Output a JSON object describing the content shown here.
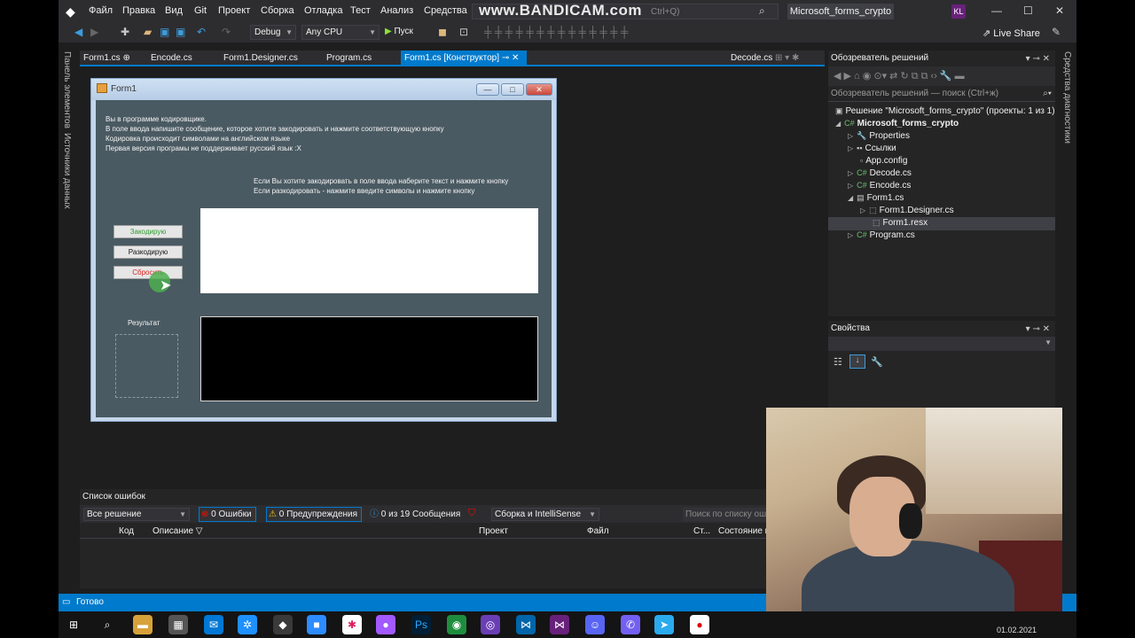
{
  "menu": [
    "Файл",
    "Правка",
    "Вид",
    "Git",
    "Проект",
    "Сборка",
    "Отладка",
    "Тест",
    "Анализ",
    "Средства",
    "Р"
  ],
  "watermark": "www.BANDICAM.com",
  "search_hint": "Ctrl+Q)",
  "solution_name": "Microsoft_forms_crypto",
  "user_initials": "KL",
  "window_buttons": {
    "minimize": "—",
    "maximize": "☐",
    "close": "✕"
  },
  "toolbar": {
    "config": "Debug",
    "platform": "Any CPU",
    "run": "Пуск",
    "live_share": "Live Share"
  },
  "left_tool_windows": [
    "Панель элементов",
    "Источники данных"
  ],
  "right_tool_windows": [
    "Средства диагностики"
  ],
  "doc_tabs": [
    {
      "label": "Form1.cs",
      "pin": "⊕"
    },
    {
      "label": "Encode.cs"
    },
    {
      "label": "Form1.Designer.cs"
    },
    {
      "label": "Program.cs"
    }
  ],
  "active_tab": "Form1.cs [Конструктор]",
  "right_tab": "Decode.cs",
  "form": {
    "title": "Form1",
    "info_lines": [
      "Вы в программе кодировщике.",
      "В поле ввода напишите сообщение, которое хотите закодировать и нажмите соответствующую кнопку",
      "Кодировка происходит символами на английском языке",
      "Первая версия програмы не поддерживает русский язык :Х"
    ],
    "hint_lines": [
      "Если Вы хотите закодировать в поле ввода наберите текст и нажмите кнопку",
      "Если разкодировать - нажмите введите символы и нажмите кнопку"
    ],
    "encode_button": "Закодирую",
    "decode_button": "Разкодирую",
    "reset_button": "Сбросить",
    "result_label": "Результат"
  },
  "solution_explorer": {
    "title": "Обозреватель решений",
    "search": "Обозреватель решений — поиск (Ctrl+ж)",
    "solution": "Решение \"Microsoft_forms_crypto\" (проекты: 1 из 1)",
    "project": "Microsoft_forms_crypto",
    "items": [
      {
        "label": "Properties"
      },
      {
        "label": "Ссылки"
      },
      {
        "label": "App.config"
      },
      {
        "label": "Decode.cs"
      },
      {
        "label": "Encode.cs"
      },
      {
        "label": "Form1.cs"
      },
      {
        "label": "Form1.Designer.cs"
      },
      {
        "label": "Form1.resx"
      },
      {
        "label": "Program.cs"
      }
    ]
  },
  "properties": {
    "title": "Свойства"
  },
  "error_list": {
    "title": "Список ошибок",
    "scope": "Все решение",
    "errors": "0 Ошибки",
    "warnings": "0 Предупреждения",
    "messages": "0 из 19 Сообщения",
    "build": "Сборка и IntelliSense",
    "search": "Поиск по списку оши",
    "columns": [
      "Код",
      "Описание",
      "Проект",
      "Файл",
      "Ст...",
      "Состояние п"
    ]
  },
  "status": "Готово",
  "taskbar_date": "01.02.2021"
}
